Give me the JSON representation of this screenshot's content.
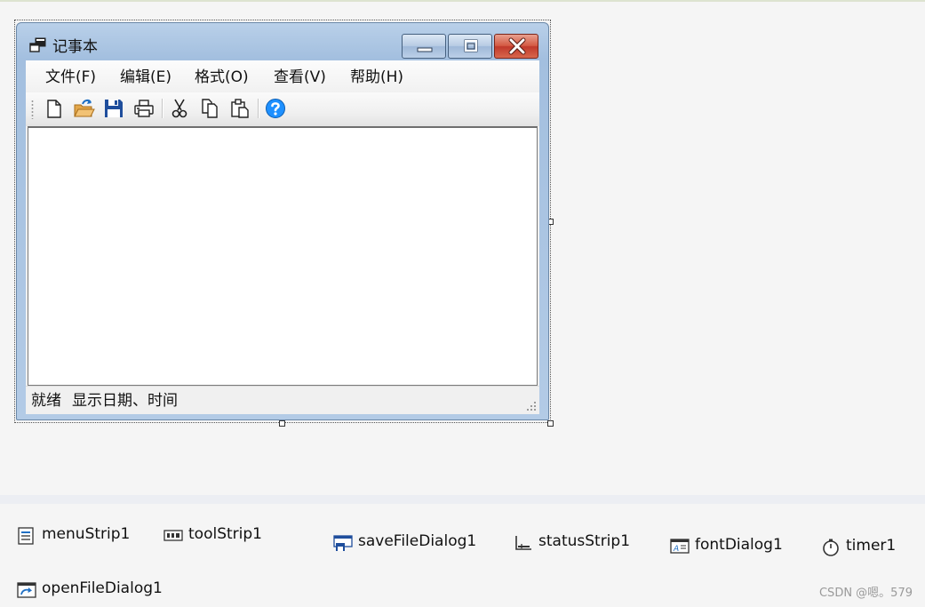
{
  "form": {
    "title": "记事本",
    "menu": [
      {
        "label": "文件(F)"
      },
      {
        "label": "编辑(E)"
      },
      {
        "label": "格式(O)"
      },
      {
        "label": "查看(V)"
      },
      {
        "label": "帮助(H)"
      }
    ],
    "toolbar": [
      {
        "icon": "new-file-icon"
      },
      {
        "icon": "open-folder-icon"
      },
      {
        "icon": "save-icon"
      },
      {
        "icon": "print-icon"
      },
      {
        "icon": "cut-icon"
      },
      {
        "icon": "copy-icon"
      },
      {
        "icon": "paste-icon"
      },
      {
        "icon": "help-icon"
      }
    ],
    "status": {
      "ready": "就绪",
      "datetime": "显示日期、时间"
    }
  },
  "components": [
    {
      "name": "menuStrip1",
      "icon": "menustrip-icon"
    },
    {
      "name": "toolStrip1",
      "icon": "toolstrip-icon"
    },
    {
      "name": "saveFileDialog1",
      "icon": "savefiledialog-icon"
    },
    {
      "name": "statusStrip1",
      "icon": "statusstrip-icon"
    },
    {
      "name": "fontDialog1",
      "icon": "fontdialog-icon"
    },
    {
      "name": "timer1",
      "icon": "timer-icon"
    },
    {
      "name": "openFileDialog1",
      "icon": "openfiledialog-icon"
    }
  ],
  "watermark": "CSDN @嗯。579",
  "colors": {
    "close_button": "#c0392b",
    "save_blue": "#1f4e9c",
    "help_blue": "#1e90ff",
    "folder_orange": "#e2a64a"
  }
}
